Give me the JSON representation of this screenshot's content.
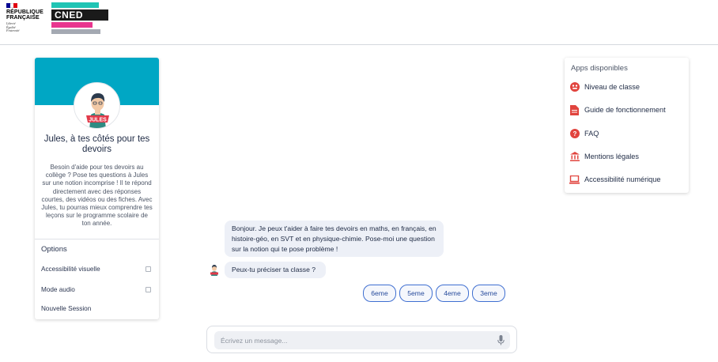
{
  "header": {
    "republique_line1": "RÉPUBLIQUE",
    "republique_line2": "FRANÇAISE",
    "devise": [
      "Liberté",
      "Égalité",
      "Fraternité"
    ],
    "cned_logo_text": "CNED"
  },
  "left_card": {
    "avatar_badge": "JULES",
    "title": "Jules, à tes côtés pour tes devoirs",
    "description": "Besoin d'aide pour tes devoirs au collège ? Pose tes questions à Jules sur une notion incomprise ! Il te répond directement avec des réponses courtes, des vidéos ou des fiches. Avec Jules, tu pourras mieux comprendre tes leçons sur le programme scolaire de ton année.",
    "options_title": "Options",
    "options": [
      {
        "label": "Accessibilité visuelle",
        "checked": false
      },
      {
        "label": "Mode audio",
        "checked": false
      },
      {
        "label": "Nouvelle Session"
      }
    ]
  },
  "apps": {
    "title": "Apps disponibles",
    "items": [
      {
        "label": "Niveau de classe",
        "icon": "level-icon"
      },
      {
        "label": "Guide de fonctionnement",
        "icon": "document-icon"
      },
      {
        "label": "FAQ",
        "icon": "help-icon"
      },
      {
        "label": "Mentions légales",
        "icon": "institution-icon"
      },
      {
        "label": "Accessibilité numérique",
        "icon": "laptop-icon"
      }
    ]
  },
  "chat": {
    "messages": [
      {
        "text": "Bonjour. Je peux t'aider à faire tes devoirs en maths, en français, en histoire-géo, en SVT et en physique-chimie. Pose-moi une question sur la notion qui te pose problème !"
      },
      {
        "text": "Peux-tu préciser ta classe ?"
      }
    ],
    "choices": [
      "6eme",
      "5eme",
      "4eme",
      "3eme"
    ],
    "input_placeholder": "Écrivez un message...",
    "input_value": ""
  },
  "colors": {
    "banner": "#00a7c4",
    "accent": "#3f6fd1",
    "icon_red": "#e1443e",
    "bubble_bg": "#edf0f7"
  }
}
